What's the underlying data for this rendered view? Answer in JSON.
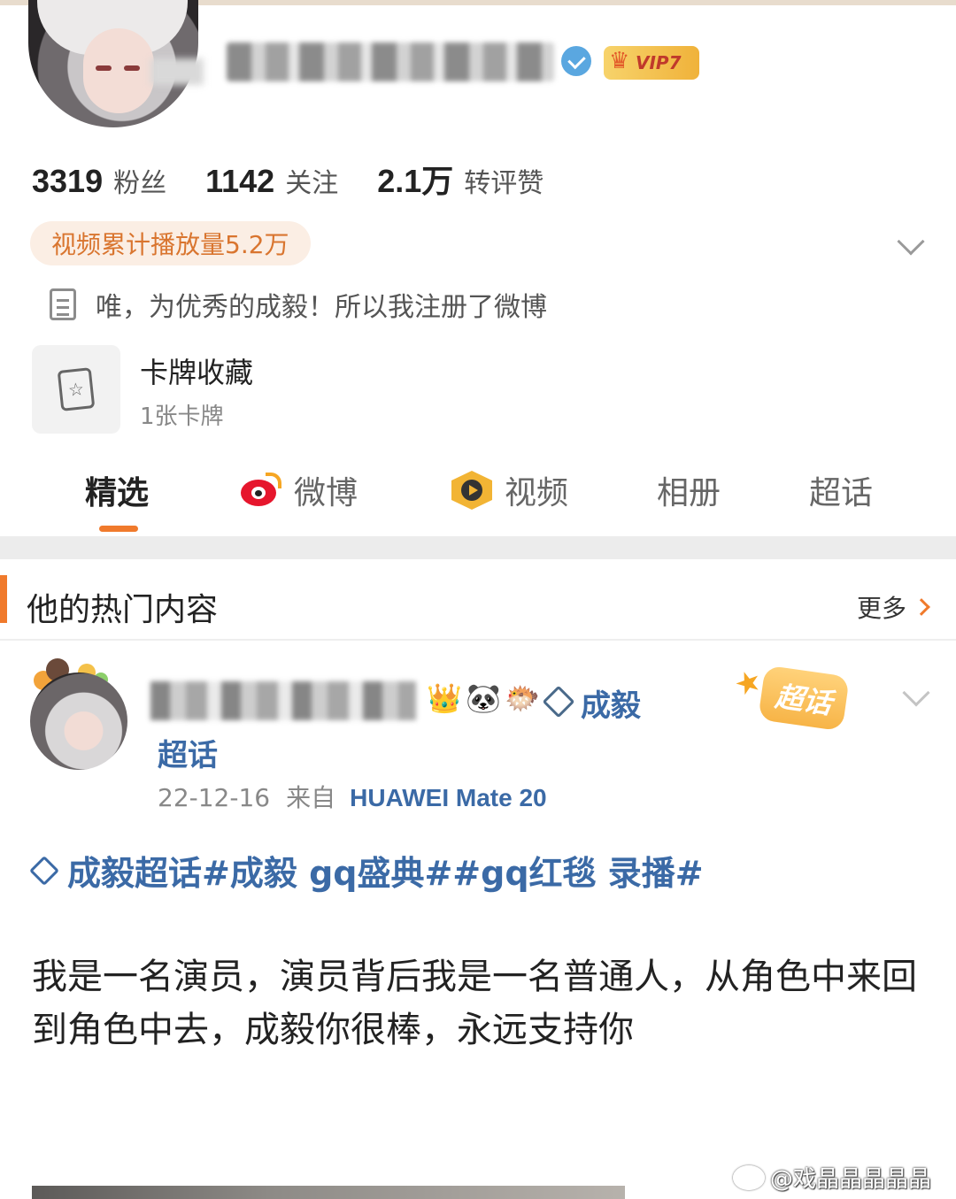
{
  "profile": {
    "badge_label": "VIP7",
    "stats": [
      {
        "value": "3319",
        "label": "粉丝"
      },
      {
        "value": "1142",
        "label": "关注"
      },
      {
        "value": "2.1万",
        "label": "转评赞"
      }
    ],
    "play_count": "视频累计播放量5.2万",
    "bio": "唯，为优秀的成毅！所以我注册了微博",
    "card": {
      "title": "卡牌收藏",
      "subtitle": "1张卡牌"
    }
  },
  "tabs": [
    {
      "label": "精选",
      "active": true
    },
    {
      "label": "微博",
      "icon": "weibo-icon"
    },
    {
      "label": "视频",
      "icon": "video-icon"
    },
    {
      "label": "相册"
    },
    {
      "label": "超话"
    }
  ],
  "hot_section": {
    "title": "他的热门内容",
    "more": "更多"
  },
  "post": {
    "topic_name": "成毅",
    "topic_suffix": "超话",
    "sticker": "超话",
    "date": "22-12-16",
    "from_label": "来自",
    "device": "HUAWEI Mate 20",
    "tags": "成毅超话#成毅 gq盛典##gq红毯 录播#",
    "body": "我是一名演员，演员背后我是一名普通人，从角色中来回到角色中去，成毅你很棒，永远支持你"
  },
  "watermark": "@戏晶晶晶晶晶",
  "colors": {
    "accent": "#f07a2c",
    "link": "#3b6aa6",
    "play_pill_bg": "#fbeee4",
    "play_pill_text": "#d9752f"
  }
}
